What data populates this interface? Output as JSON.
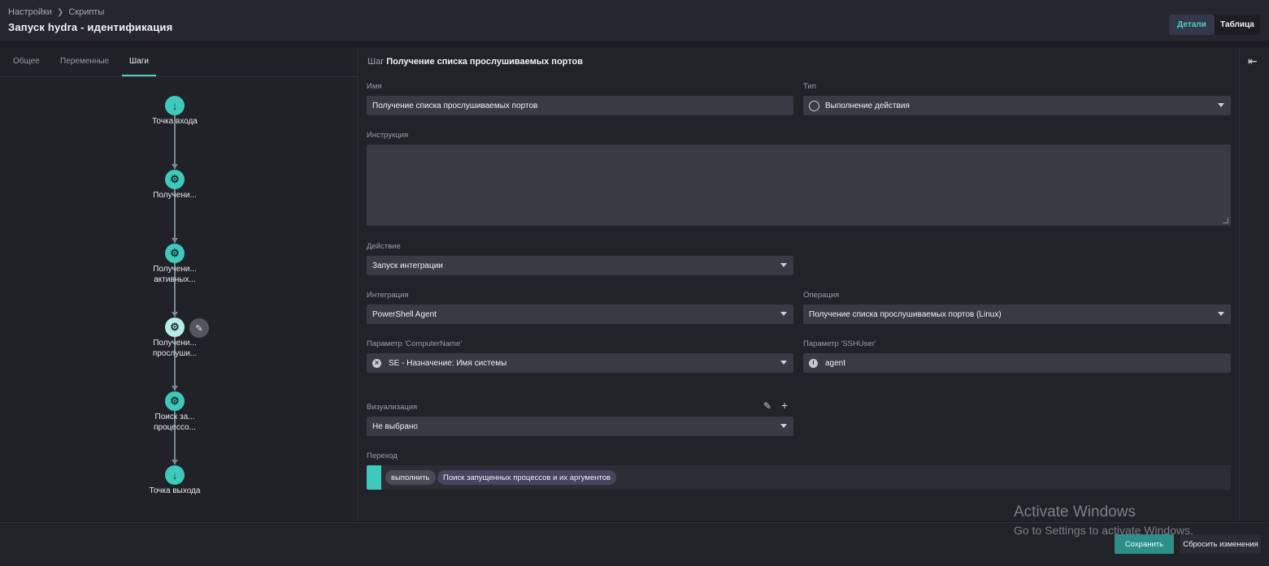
{
  "breadcrumb": {
    "root": "Настройки",
    "current": "Скрипты"
  },
  "page_title": "Запуск hydra - идентификация",
  "view_toggle": {
    "details": "Детали",
    "table": "Таблица"
  },
  "tabs": [
    {
      "label": "Общее"
    },
    {
      "label": "Переменные"
    },
    {
      "label": "Шаги"
    }
  ],
  "flow": {
    "entry": "Точка входа",
    "steps": [
      {
        "line1": "Получени...",
        "line2": ""
      },
      {
        "line1": "Получени...",
        "line2": "активных..."
      },
      {
        "line1": "Получени...",
        "line2": "прослуши..."
      },
      {
        "line1": "Поиск за...",
        "line2": "процессо..."
      }
    ],
    "exit": "Точка выхода"
  },
  "step": {
    "prefix": "Шаг",
    "name": "Получение списка прослушиваемых портов",
    "name_label": "Имя",
    "name_value": "Получение списка прослушиваемых портов",
    "type_label": "Тип",
    "type_value": "Выполнение действия",
    "instruction_label": "Инструкция",
    "action_label": "Действие",
    "action_value": "Запуск интеграции",
    "integration_label": "Интеграция",
    "integration_value": "PowerShell Agent",
    "operation_label": "Операция",
    "operation_value": "Получение списка прослушиваемых портов (Linux)",
    "param1_label": "Параметр 'ComputerName'",
    "param1_value": "SE - Назначение: Имя системы",
    "param2_label": "Параметр 'SSHUser'",
    "param2_value": "agent",
    "visualization_label": "Визуализация",
    "visualization_value": "Не выбрано",
    "transition_label": "Переход",
    "transition_chip1": "выполнить",
    "transition_chip2": "Поиск запущенных процессов и их аргументов"
  },
  "footer": {
    "save": "Сохранить",
    "reset": "Сбросить изменения"
  },
  "watermark": {
    "line1": "Activate Windows",
    "line2": "Go to Settings to activate Windows."
  },
  "colors": {
    "accent": "#3ec9bc",
    "background": "#1c1c22",
    "panel": "#222229",
    "field": "#3a3a45"
  }
}
